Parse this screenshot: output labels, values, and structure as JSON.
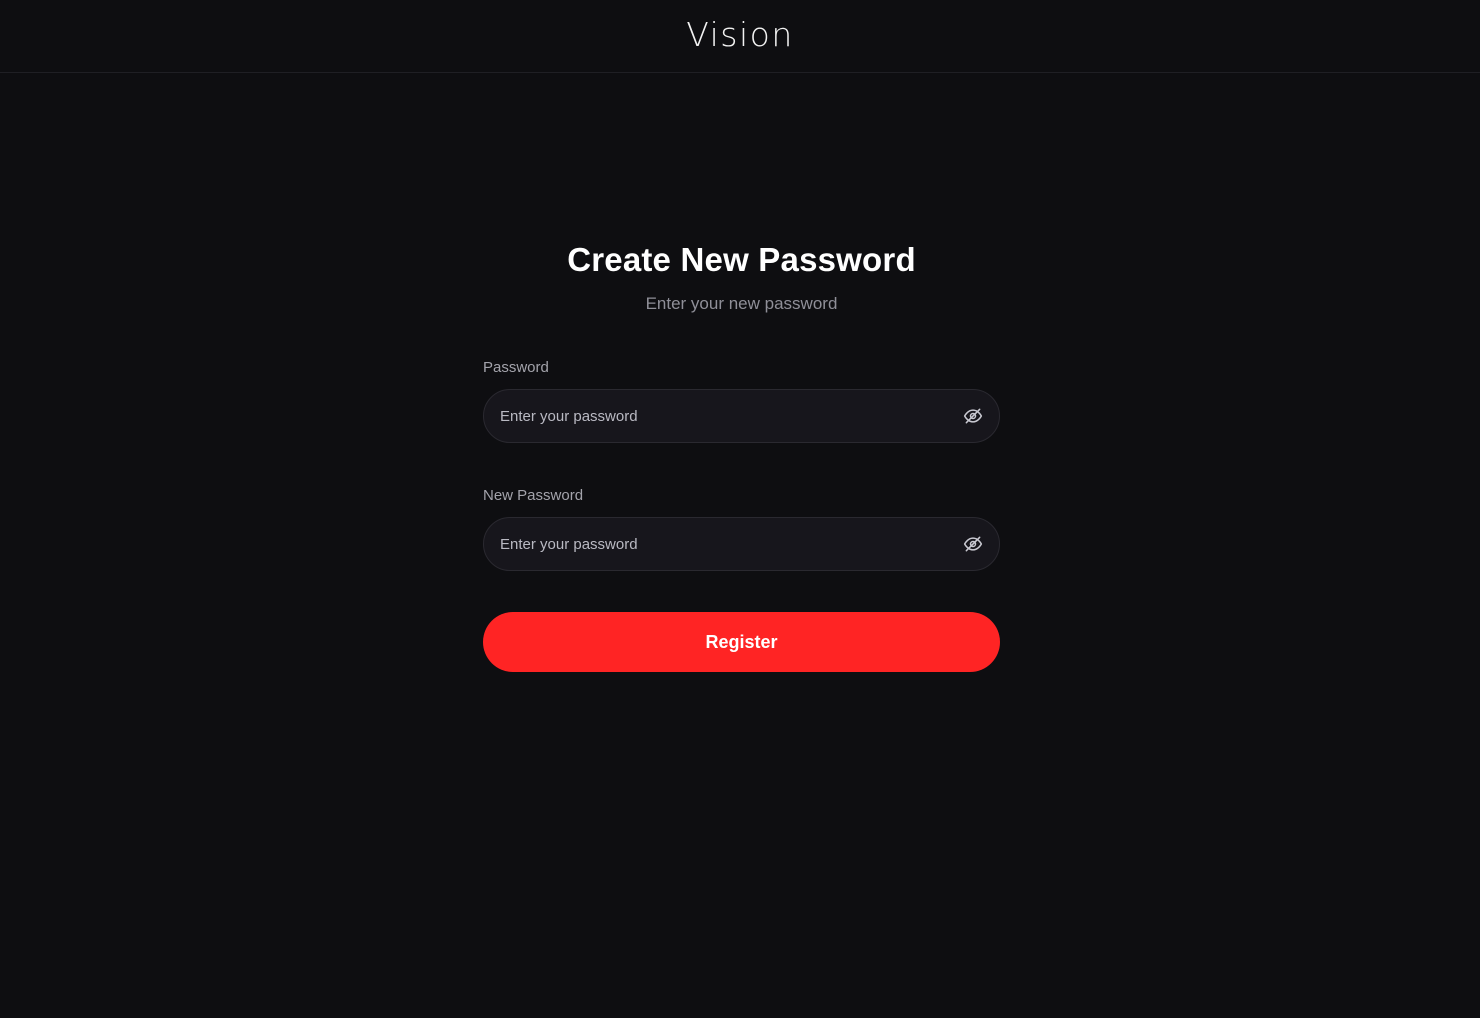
{
  "header": {
    "logo_text": "Vision"
  },
  "form": {
    "title": "Create New Password",
    "subtitle": "Enter your new password",
    "password": {
      "label": "Password",
      "placeholder": "Enter your password",
      "value": "",
      "toggle_icon": "eye-off-icon"
    },
    "new_password": {
      "label": "New Password",
      "placeholder": "Enter your password",
      "value": "",
      "toggle_icon": "eye-off-icon"
    },
    "submit_label": "Register"
  },
  "colors": {
    "background": "#0e0e11",
    "input_background": "#17161c",
    "accent": "#ff2424",
    "muted_text": "#8f8f98"
  }
}
